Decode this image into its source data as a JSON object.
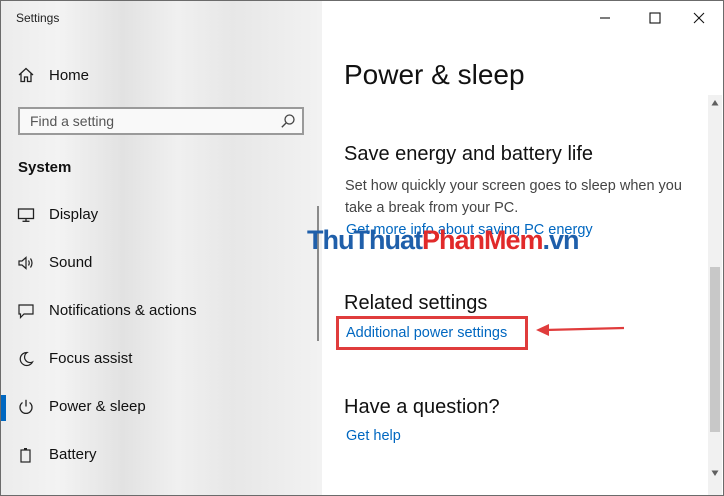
{
  "window": {
    "app_title": "Settings"
  },
  "sidebar": {
    "home_label": "Home",
    "search": {
      "placeholder": "Find a setting",
      "value": ""
    },
    "section_label": "System",
    "items": [
      {
        "label": "Display",
        "icon": "display-icon"
      },
      {
        "label": "Sound",
        "icon": "speaker-icon"
      },
      {
        "label": "Notifications & actions",
        "icon": "notification-icon"
      },
      {
        "label": "Focus assist",
        "icon": "moon-icon"
      },
      {
        "label": "Power & sleep",
        "icon": "power-icon",
        "active": true
      },
      {
        "label": "Battery",
        "icon": "battery-icon"
      }
    ]
  },
  "content": {
    "page_title": "Power & sleep",
    "save_energy": {
      "heading": "Save energy and battery life",
      "description": "Set how quickly your screen goes to sleep when you take a break from your PC.",
      "link": "Get more info about saving PC energy"
    },
    "related": {
      "heading": "Related settings",
      "link": "Additional power settings"
    },
    "question": {
      "heading": "Have a question?",
      "link": "Get help"
    },
    "watermark": {
      "part1": "ThuThuat",
      "part2": "PhanMem",
      "part3": ".vn"
    }
  },
  "colors": {
    "accent": "#0067c0",
    "highlight": "#e03c3c",
    "watermark_blue": "#1f5faa",
    "watermark_red": "#e12a2a"
  }
}
